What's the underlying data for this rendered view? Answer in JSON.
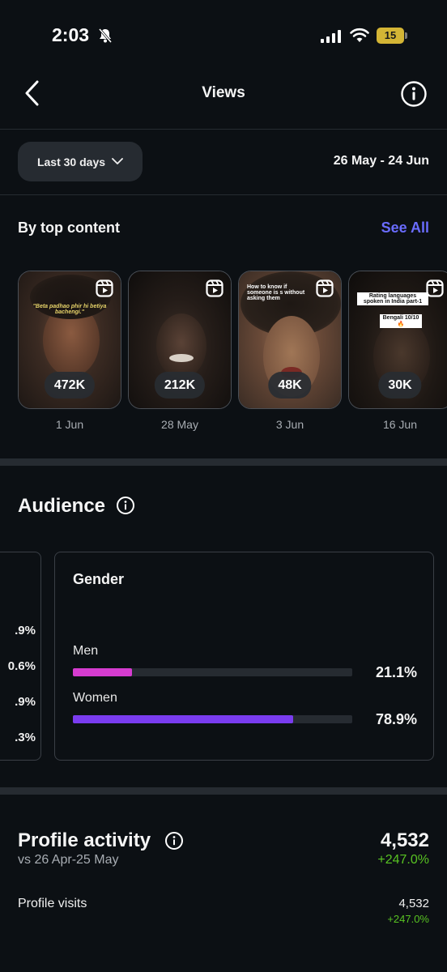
{
  "status": {
    "time": "2:03",
    "battery": "15"
  },
  "header": {
    "title": "Views"
  },
  "filter": {
    "range_label": "Last 30 days",
    "date_range": "26 May - 24 Jun"
  },
  "top_content": {
    "heading": "By top content",
    "see_all": "See All",
    "items": [
      {
        "views": "472K",
        "date": "1 Jun",
        "caption": "\"Beta padhao phir hi betiya bachengi.\""
      },
      {
        "views": "212K",
        "date": "28 May",
        "caption": ""
      },
      {
        "views": "48K",
        "date": "3 Jun",
        "caption": "How to know if someone is s without asking them"
      },
      {
        "views": "30K",
        "date": "16 Jun",
        "caption": "Rating languages spoken in India part-1",
        "caption2": "Bengali 10/10🔥"
      }
    ]
  },
  "audience": {
    "title": "Audience",
    "left_card_partial": [
      ".9%",
      "0.6%",
      ".9%",
      ".3%"
    ],
    "gender": {
      "title": "Gender",
      "rows": [
        {
          "label": "Men",
          "pct": "21.1%",
          "value": 21.1,
          "color": "#d63cd0"
        },
        {
          "label": "Women",
          "pct": "78.9%",
          "value": 78.9,
          "color": "#7a3cf0"
        }
      ]
    }
  },
  "profile_activity": {
    "title": "Profile activity",
    "compare": "vs 26 Apr-25 May",
    "total": "4,532",
    "change": "+247.0%",
    "visits_label": "Profile visits",
    "visits_value": "4,532",
    "visits_change": "+247.0%"
  },
  "colors": {
    "accent_link": "#6a6cff",
    "positive": "#58c322",
    "background": "#0c1014"
  }
}
